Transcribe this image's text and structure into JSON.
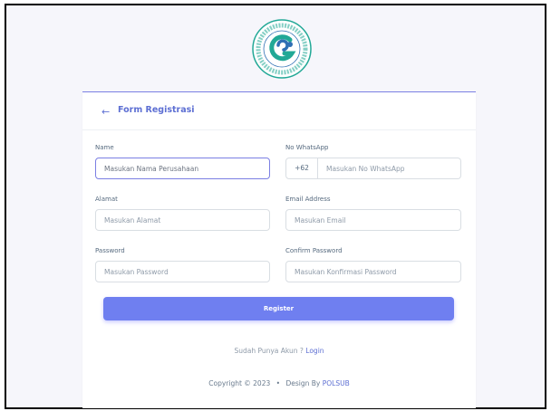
{
  "colors": {
    "accent": "#6f7ff0",
    "link": "#5d6fd3",
    "logo_teal": "#21a896",
    "logo_blue": "#2e6fb4"
  },
  "header": {
    "back_icon": "arrow-left-icon",
    "title": "Form Registrasi"
  },
  "form": {
    "name": {
      "label": "Name",
      "placeholder": "Masukan Nama Perusahaan"
    },
    "whatsapp": {
      "label": "No WhatsApp",
      "prefix": "+62",
      "placeholder": "Masukan No WhatsApp"
    },
    "alamat": {
      "label": "Alamat",
      "placeholder": "Masukan Alamat"
    },
    "email": {
      "label": "Email Address",
      "placeholder": "Masukan Email"
    },
    "password": {
      "label": "Password",
      "placeholder": "Masukan Password"
    },
    "confirm_password": {
      "label": "Confirm Password",
      "placeholder": "Masukan Konfirmasi Password"
    },
    "register_label": "Register"
  },
  "footer": {
    "login_prompt": "Sudah Punya Akun ?",
    "login_link": "Login",
    "copyright": "Copyright © 2023",
    "bullet": "•",
    "design_by": "Design By",
    "designer": "POLSUB"
  }
}
